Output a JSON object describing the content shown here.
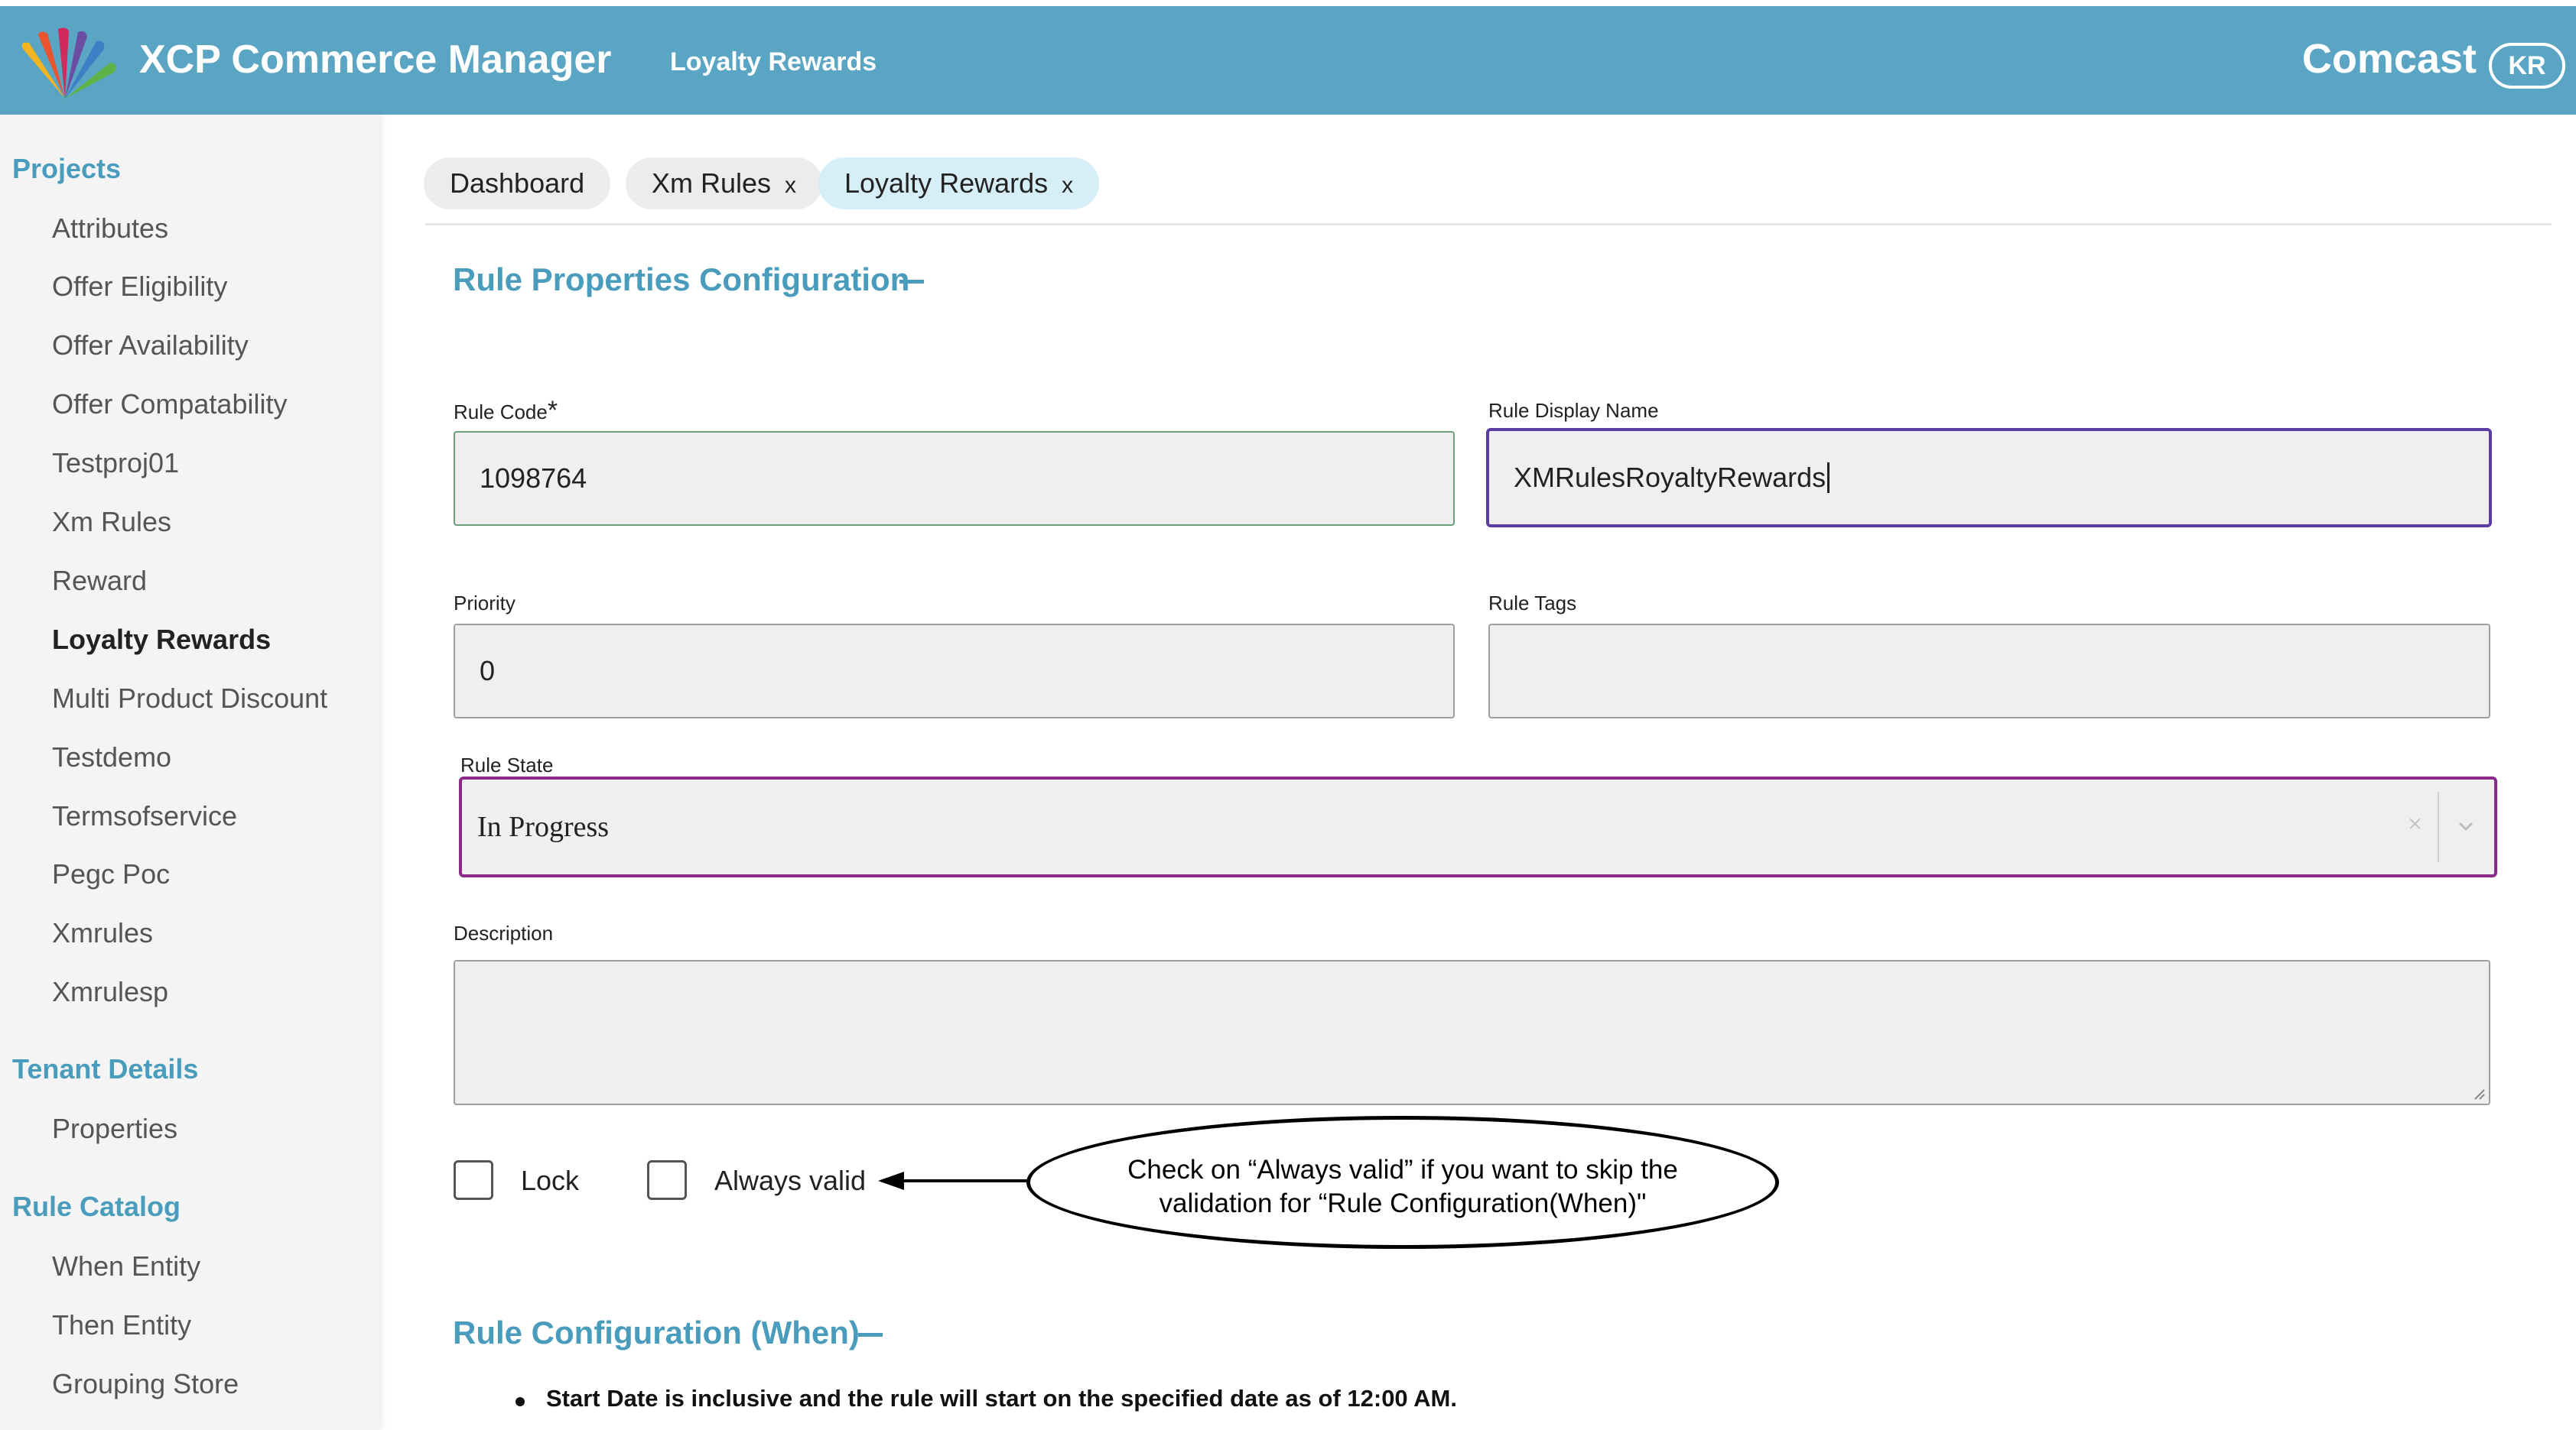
{
  "header": {
    "app_title": "XCP Commerce Manager",
    "subtitle": "Loyalty Rewards",
    "brand": "Comcast",
    "avatar_initials": "KR",
    "logo_icon": "peacock-logo-icon",
    "logo_colors": [
      "#f2b51f",
      "#e9532f",
      "#cf2b5c",
      "#6b4ea3",
      "#3b7fc4",
      "#5fb247"
    ]
  },
  "sidebar": {
    "projects_heading": "Projects",
    "projects": [
      "Attributes",
      "Offer Eligibility",
      "Offer Availability",
      "Offer Compatability",
      "Testproj01",
      "Xm Rules",
      "Reward",
      "Loyalty Rewards",
      "Multi Product Discount",
      "Testdemo",
      "Termsofservice",
      "Pegc Poc",
      "Xmrules",
      "Xmrulesp"
    ],
    "active_project": "Loyalty Rewards",
    "tenant_heading": "Tenant Details",
    "tenant_items": [
      "Properties"
    ],
    "catalog_heading": "Rule Catalog",
    "catalog_items": [
      "When Entity",
      "Then Entity",
      "Grouping Store"
    ]
  },
  "tabs": [
    {
      "label": "Dashboard",
      "closable": false
    },
    {
      "label": "Xm Rules",
      "closable": true
    },
    {
      "label": "Loyalty Rewards",
      "closable": true,
      "active": true
    }
  ],
  "tab_close_glyph": "x",
  "rule_properties": {
    "title": "Rule Properties Configuration",
    "rule_code_label": "Rule Code",
    "rule_code_required": "*",
    "rule_code_value": "1098764",
    "display_name_label": "Rule Display Name",
    "display_name_value": "XMRulesRoyaltyRewards",
    "priority_label": "Priority",
    "priority_value": "0",
    "tags_label": "Rule Tags",
    "tags_value": "",
    "state_label": "Rule State",
    "state_value": "In Progress",
    "state_clear_glyph": "×",
    "description_label": "Description",
    "description_value": "",
    "lock_label": "Lock",
    "always_valid_label": "Always valid"
  },
  "callout": {
    "line1": "Check on “Always valid” if you want to skip the",
    "line2": "validation for “Rule Configuration(When)\""
  },
  "rule_config_when": {
    "title": "Rule Configuration (When)",
    "note": "Start Date is inclusive and the rule will start on the specified date as of 12:00 AM."
  },
  "colors": {
    "header_bg": "#5aa5c3",
    "accent": "#4a9cbd",
    "focus_border": "#5b3ca1",
    "select_border": "#8c2a8a"
  }
}
